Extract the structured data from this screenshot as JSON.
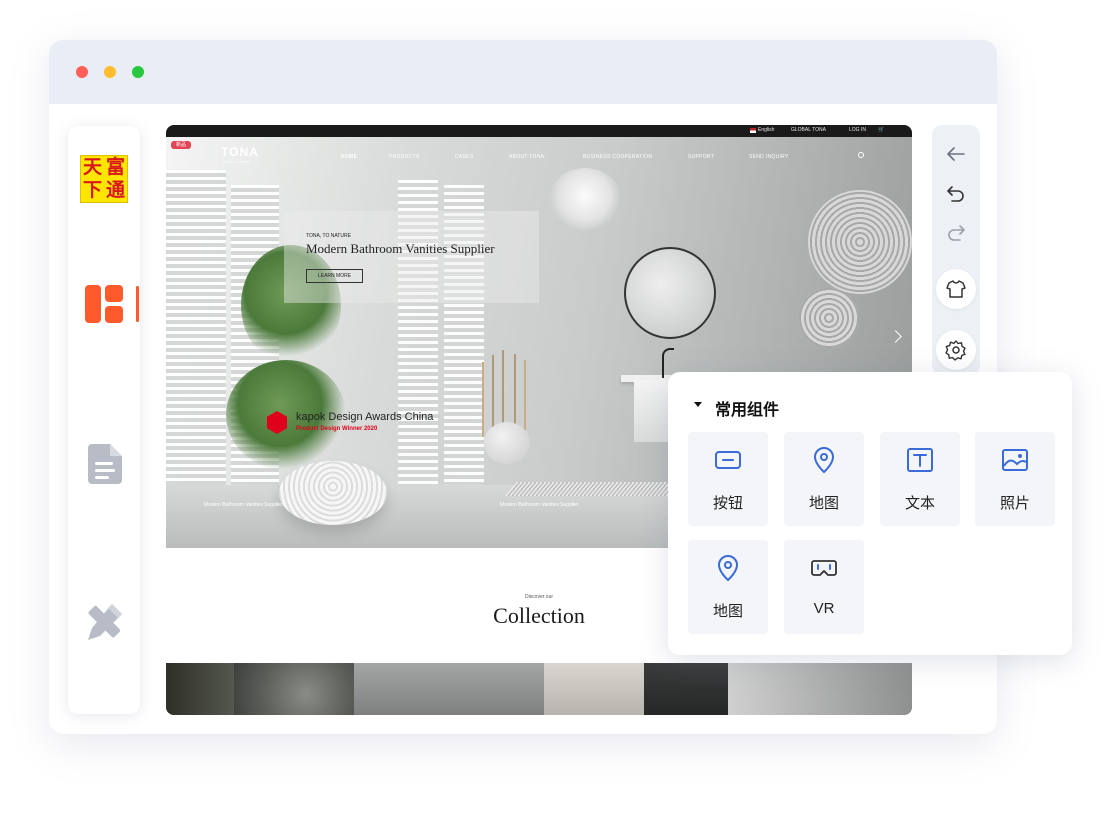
{
  "window": {
    "traffic_lights": [
      "close",
      "minimize",
      "maximize"
    ]
  },
  "sidebar": {
    "logo_chars": [
      "天",
      "富",
      "下",
      "通"
    ],
    "items": [
      {
        "icon": "layout-icon",
        "active": true
      },
      {
        "icon": "document-icon",
        "active": false
      },
      {
        "icon": "pencil-ruler-icon",
        "active": false
      }
    ],
    "accent_color": "#ff5a2b"
  },
  "preview": {
    "topbar": {
      "language": "English",
      "region": "GLOBAL TONA",
      "login": "LOG IN"
    },
    "badge": "新品",
    "brand": "TONA",
    "brand_sub": "LESS IS MORE",
    "nav": [
      "HOME",
      "PRODUCTS",
      "CASES",
      "ABOUT TONA",
      "BUSINESS COOPERATION",
      "SUPPORT",
      "SEND INQUIRY"
    ],
    "hero": {
      "tagline": "TONA, TO NATURE",
      "headline": "Modern Bathroom Vanities Supplier",
      "cta": "LEARN MORE",
      "award_title": "kapok Design Awards China",
      "award_sub": "Product Design Winner 2020",
      "caption_left": "Modern Bathroom Vanities Supplier",
      "caption_right": "Modern Bathroom Vanities Supplier"
    },
    "section": {
      "kicker": "Discover our",
      "title": "Collection"
    }
  },
  "toolbar": {
    "buttons": [
      "back-arrow-icon",
      "undo-icon",
      "redo-icon",
      "shirt-icon",
      "gear-icon"
    ]
  },
  "components_panel": {
    "title": "常用组件",
    "items": [
      {
        "label": "按钮",
        "icon": "button-icon"
      },
      {
        "label": "地图",
        "icon": "map-pin-icon"
      },
      {
        "label": "文本",
        "icon": "text-icon"
      },
      {
        "label": "照片",
        "icon": "photo-icon"
      },
      {
        "label": "地图",
        "icon": "map-pin-icon"
      },
      {
        "label": "VR",
        "icon": "vr-icon"
      }
    ],
    "icon_color": "#3a6bd8"
  }
}
